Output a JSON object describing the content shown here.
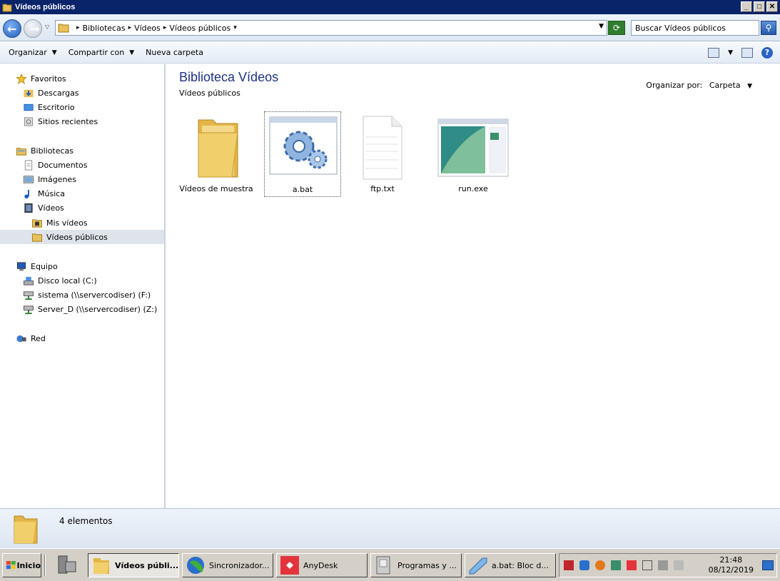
{
  "window": {
    "title": "Vídeos públicos",
    "buttons": [
      "_",
      "□",
      "✕"
    ]
  },
  "address": {
    "crumbs": [
      "Bibliotecas",
      "Vídeos",
      "Vídeos públicos"
    ],
    "search_placeholder": "Buscar Vídeos públicos"
  },
  "toolbar": {
    "organize": "Organizar",
    "share": "Compartir con",
    "new_folder": "Nueva carpeta"
  },
  "nav": {
    "favorites": "Favoritos",
    "downloads": "Descargas",
    "desktop": "Escritorio",
    "recent": "Sitios recientes",
    "libraries": "Bibliotecas",
    "documents": "Documentos",
    "images": "Imágenes",
    "music": "Música",
    "videos": "Vídeos",
    "my_videos": "Mis vídeos",
    "public_videos": "Vídeos públicos",
    "computer": "Equipo",
    "local_disk": "Disco local (C:)",
    "drive_f": "sistema (\\\\servercodiser) (F:)",
    "drive_z": "Server_D (\\\\servercodiser) (Z:)",
    "network": "Red"
  },
  "content": {
    "title": "Biblioteca Vídeos",
    "subtitle": "Vídeos públicos",
    "arrange_label": "Organizar por:",
    "arrange_value": "Carpeta",
    "items": [
      {
        "name": "Vídeos de muestra",
        "icon": "folder-icon"
      },
      {
        "name": "a.bat",
        "icon": "gears-icon"
      },
      {
        "name": "ftp.txt",
        "icon": "text-file-icon"
      },
      {
        "name": "run.exe",
        "icon": "exe-file-icon"
      }
    ]
  },
  "details": {
    "count": "4 elementos"
  },
  "taskbar": {
    "start": "Inicio",
    "buttons": [
      "Vídeos públi...",
      "Sincronizador...",
      "AnyDesk",
      "Programas y ...",
      "a.bat: Bloc d..."
    ],
    "time": "21:48",
    "date": "08/12/2019"
  },
  "colors": {
    "title_bar": "#0a246a",
    "library_title": "#1e3287",
    "selection": "#dfe4ea"
  }
}
